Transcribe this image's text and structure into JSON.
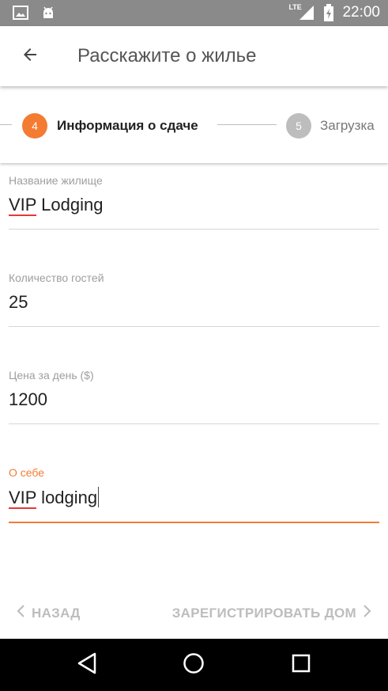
{
  "status_bar": {
    "network": "LTE",
    "time": "22:00",
    "icons": [
      "image-icon",
      "android-icon",
      "signal-icon",
      "battery-icon"
    ]
  },
  "app_bar": {
    "back_icon": "arrow-back-icon",
    "title": "Расскажите о жилье"
  },
  "stepper": {
    "current": {
      "number": "4",
      "label": "Информация о сдаче",
      "color": "#f47b32"
    },
    "next": {
      "number": "5",
      "label": "Загрузка",
      "color": "#bdbdbd"
    }
  },
  "form": {
    "fields": [
      {
        "label": "Название жилище",
        "value_prefix": "VIP",
        "value_rest": " Lodging"
      },
      {
        "label": "Количество гостей",
        "value": "25"
      },
      {
        "label": "Цена за день ($)",
        "value": "1200"
      },
      {
        "label": "О себе",
        "value_prefix": "VIP",
        "value_rest": " lodging",
        "active": true
      }
    ]
  },
  "bottom_nav": {
    "back_label": "НАЗАД",
    "register_label": "ЗАРЕГИСТРИРОВАТЬ ДОМ"
  },
  "colors": {
    "accent": "#f47b32",
    "disabled": "#bdbdbd",
    "status_bar": "#8a8a8a"
  }
}
